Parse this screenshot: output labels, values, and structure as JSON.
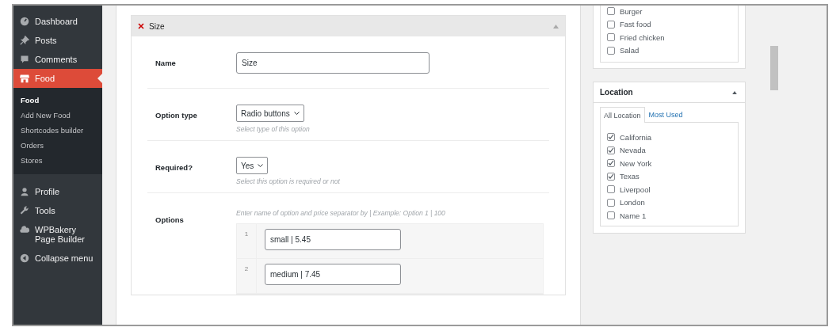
{
  "sidebar": {
    "items": [
      {
        "label": "Dashboard",
        "selected": false
      },
      {
        "label": "Posts",
        "selected": false
      },
      {
        "label": "Comments",
        "selected": false
      },
      {
        "label": "Food",
        "selected": true,
        "children": [
          {
            "label": "Food",
            "selected": true
          },
          {
            "label": "Add New Food",
            "selected": false
          },
          {
            "label": "Shortcodes builder",
            "selected": false
          },
          {
            "label": "Orders",
            "selected": false
          },
          {
            "label": "Stores",
            "selected": false
          }
        ]
      },
      {
        "label": "Profile",
        "selected": false
      },
      {
        "label": "Tools",
        "selected": false
      },
      {
        "label": "WPBakery Page Builder",
        "selected": false
      },
      {
        "label": "Collapse menu",
        "selected": false
      }
    ]
  },
  "metabox": {
    "title": "Size",
    "fields": [
      {
        "kind": "text",
        "label": "Name",
        "value": "Size"
      },
      {
        "kind": "select",
        "label": "Option type",
        "value": "Radio buttons",
        "hint": "Select type of this option"
      },
      {
        "kind": "select",
        "label": "Required?",
        "value": "Yes",
        "hint": "Select this option is required or not"
      },
      {
        "kind": "options",
        "label": "Options",
        "hint": "Enter name of option and price separator by | Example: Option 1 | 100",
        "rows": [
          {
            "number": "1",
            "value": "small | 5.45"
          },
          {
            "number": "2",
            "value": "medium | 7.45"
          }
        ]
      }
    ]
  },
  "categories": {
    "items": [
      {
        "label": "Burger",
        "checked": false
      },
      {
        "label": "Fast food",
        "checked": false
      },
      {
        "label": "Fried chicken",
        "checked": false
      },
      {
        "label": "Salad",
        "checked": false
      }
    ]
  },
  "location": {
    "title": "Location",
    "tabs": [
      {
        "label": "All Location",
        "selected": true
      },
      {
        "label": "Most Used",
        "selected": false
      }
    ],
    "items": [
      {
        "label": "California",
        "checked": true
      },
      {
        "label": "Nevada",
        "checked": true
      },
      {
        "label": "New York",
        "checked": true
      },
      {
        "label": "Texas",
        "checked": true
      },
      {
        "label": "Liverpool",
        "checked": false
      },
      {
        "label": "London",
        "checked": false
      },
      {
        "label": "Name 1",
        "checked": false
      }
    ]
  }
}
